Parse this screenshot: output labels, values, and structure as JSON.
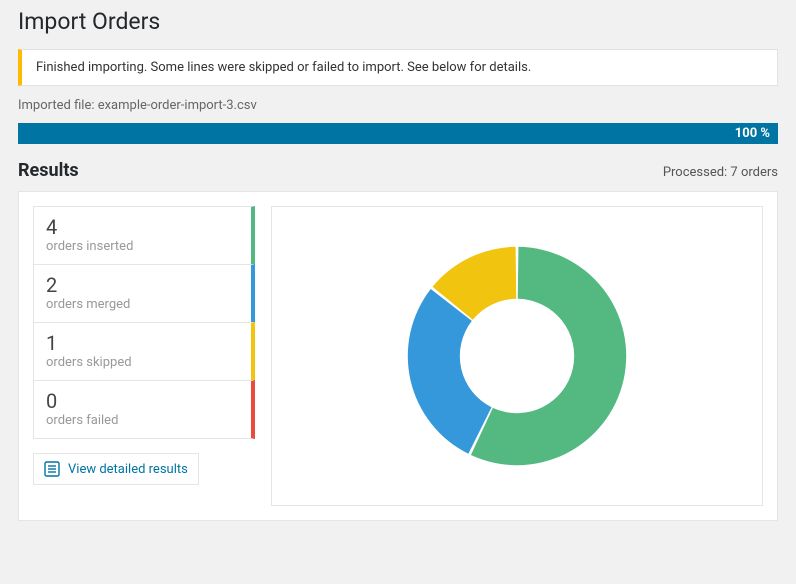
{
  "page_title": "Import Orders",
  "notice": "Finished importing. Some lines were skipped or failed to import. See below for details.",
  "imported_file_label": "Imported file:",
  "imported_file_name": "example-order-import-3.csv",
  "progress_text": "100 %",
  "results_title": "Results",
  "processed_text": "Processed: 7 orders",
  "stats": {
    "inserted": {
      "count": "4",
      "label": "orders inserted",
      "color": "#54b981"
    },
    "merged": {
      "count": "2",
      "label": "orders merged",
      "color": "#3498db"
    },
    "skipped": {
      "count": "1",
      "label": "orders skipped",
      "color": "#f1c40f"
    },
    "failed": {
      "count": "0",
      "label": "orders failed",
      "color": "#e74c3c"
    }
  },
  "view_detailed_label": "View detailed results",
  "chart_data": {
    "type": "pie",
    "title": "",
    "series": [
      {
        "name": "orders inserted",
        "value": 4,
        "color": "#54b981"
      },
      {
        "name": "orders merged",
        "value": 2,
        "color": "#3498db"
      },
      {
        "name": "orders skipped",
        "value": 1,
        "color": "#f1c40f"
      },
      {
        "name": "orders failed",
        "value": 0,
        "color": "#e74c3c"
      }
    ],
    "donut": true
  }
}
